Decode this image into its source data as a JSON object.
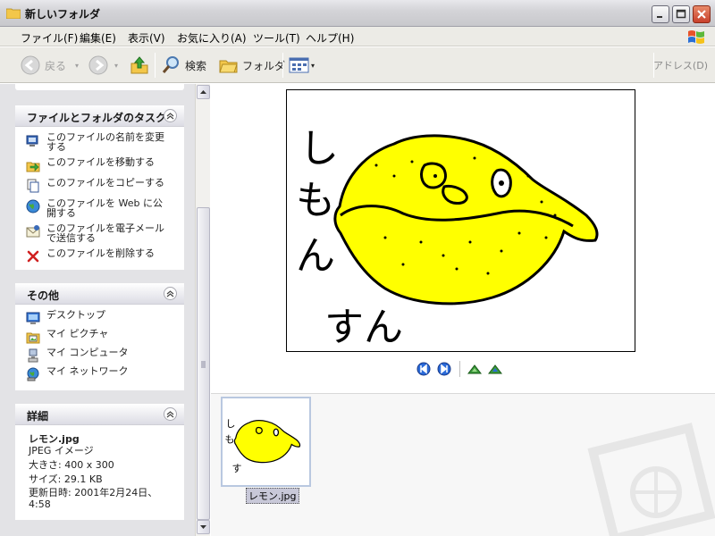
{
  "window": {
    "title": "新しいフォルダ"
  },
  "menu": [
    "ファイル(F)",
    "編集(E)",
    "表示(V)",
    "お気に入り(A)",
    "ツール(T)",
    "ヘルプ(H)"
  ],
  "toolbar": {
    "back": "戻る",
    "search": "検索",
    "folders": "フォルダ",
    "address": "アドレス(D)"
  },
  "tasks_panel": {
    "title": "ファイルとフォルダのタスク",
    "items": [
      {
        "label": "このファイルの名前を変更する",
        "icon": "rename-icon"
      },
      {
        "label": "このファイルを移動する",
        "icon": "move-icon"
      },
      {
        "label": "このファイルをコピーする",
        "icon": "copy-icon"
      },
      {
        "label": "このファイルを Web に公開する",
        "icon": "web-publish-icon"
      },
      {
        "label": "このファイルを電子メールで送信する",
        "icon": "email-icon"
      },
      {
        "label": "このファイルを削除する",
        "icon": "delete-icon"
      }
    ]
  },
  "other_panel": {
    "title": "その他",
    "items": [
      {
        "label": "デスクトップ",
        "icon": "desktop-icon"
      },
      {
        "label": "マイ ピクチャ",
        "icon": "my-pictures-icon"
      },
      {
        "label": "マイ コンピュータ",
        "icon": "my-computer-icon"
      },
      {
        "label": "マイ ネットワーク",
        "icon": "my-network-icon"
      }
    ]
  },
  "details_panel": {
    "title": "詳細",
    "filename": "レモン.jpg",
    "type": "JPEG イメージ",
    "size_dims": "大きさ: 400 x 300",
    "size_bytes": "サイズ: 29.1 KB",
    "modified": "更新日時: 2001年2月24日、4:58"
  },
  "preview": {
    "drawn_text": "しもんすん"
  },
  "filmstrip": {
    "selected_file": "レモン.jpg"
  },
  "colors": {
    "lemon": "#ffff00",
    "task_pane": "#e3e3e6",
    "titlebar": "#d4d4d8"
  }
}
